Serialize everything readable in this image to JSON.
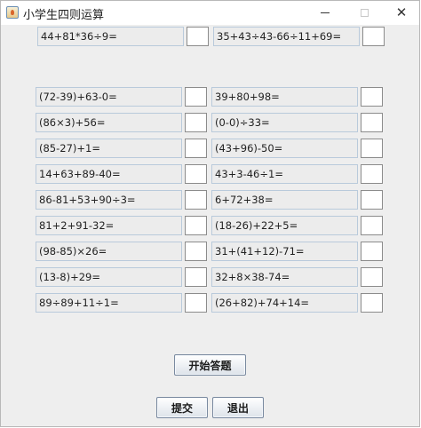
{
  "window": {
    "title": "小学生四则运算"
  },
  "questions": [
    {
      "expr": "44+81*36÷9=",
      "answer": ""
    },
    {
      "expr": "35+43÷43-66÷11+69=",
      "answer": ""
    },
    {
      "expr": "(72-39)+63-0=",
      "answer": ""
    },
    {
      "expr": "39+80+98=",
      "answer": ""
    },
    {
      "expr": "(86×3)+56=",
      "answer": ""
    },
    {
      "expr": "(0-0)÷33=",
      "answer": ""
    },
    {
      "expr": "(85-27)+1=",
      "answer": ""
    },
    {
      "expr": "(43+96)-50=",
      "answer": ""
    },
    {
      "expr": "14+63+89-40=",
      "answer": ""
    },
    {
      "expr": "43+3-46÷1=",
      "answer": ""
    },
    {
      "expr": "86-81+53+90÷3=",
      "answer": ""
    },
    {
      "expr": "6+72+38=",
      "answer": ""
    },
    {
      "expr": "81+2+91-32=",
      "answer": ""
    },
    {
      "expr": "(18-26)+22+5=",
      "answer": ""
    },
    {
      "expr": "(98-85)×26=",
      "answer": ""
    },
    {
      "expr": "31+(41+12)-71=",
      "answer": ""
    },
    {
      "expr": "(13-8)+29=",
      "answer": ""
    },
    {
      "expr": "32+8×38-74=",
      "answer": ""
    },
    {
      "expr": "89÷89+11÷1=",
      "answer": ""
    },
    {
      "expr": "(26+82)+74+14=",
      "answer": ""
    }
  ],
  "buttons": {
    "start": "开始答题",
    "submit": "提交",
    "exit": "退出"
  }
}
